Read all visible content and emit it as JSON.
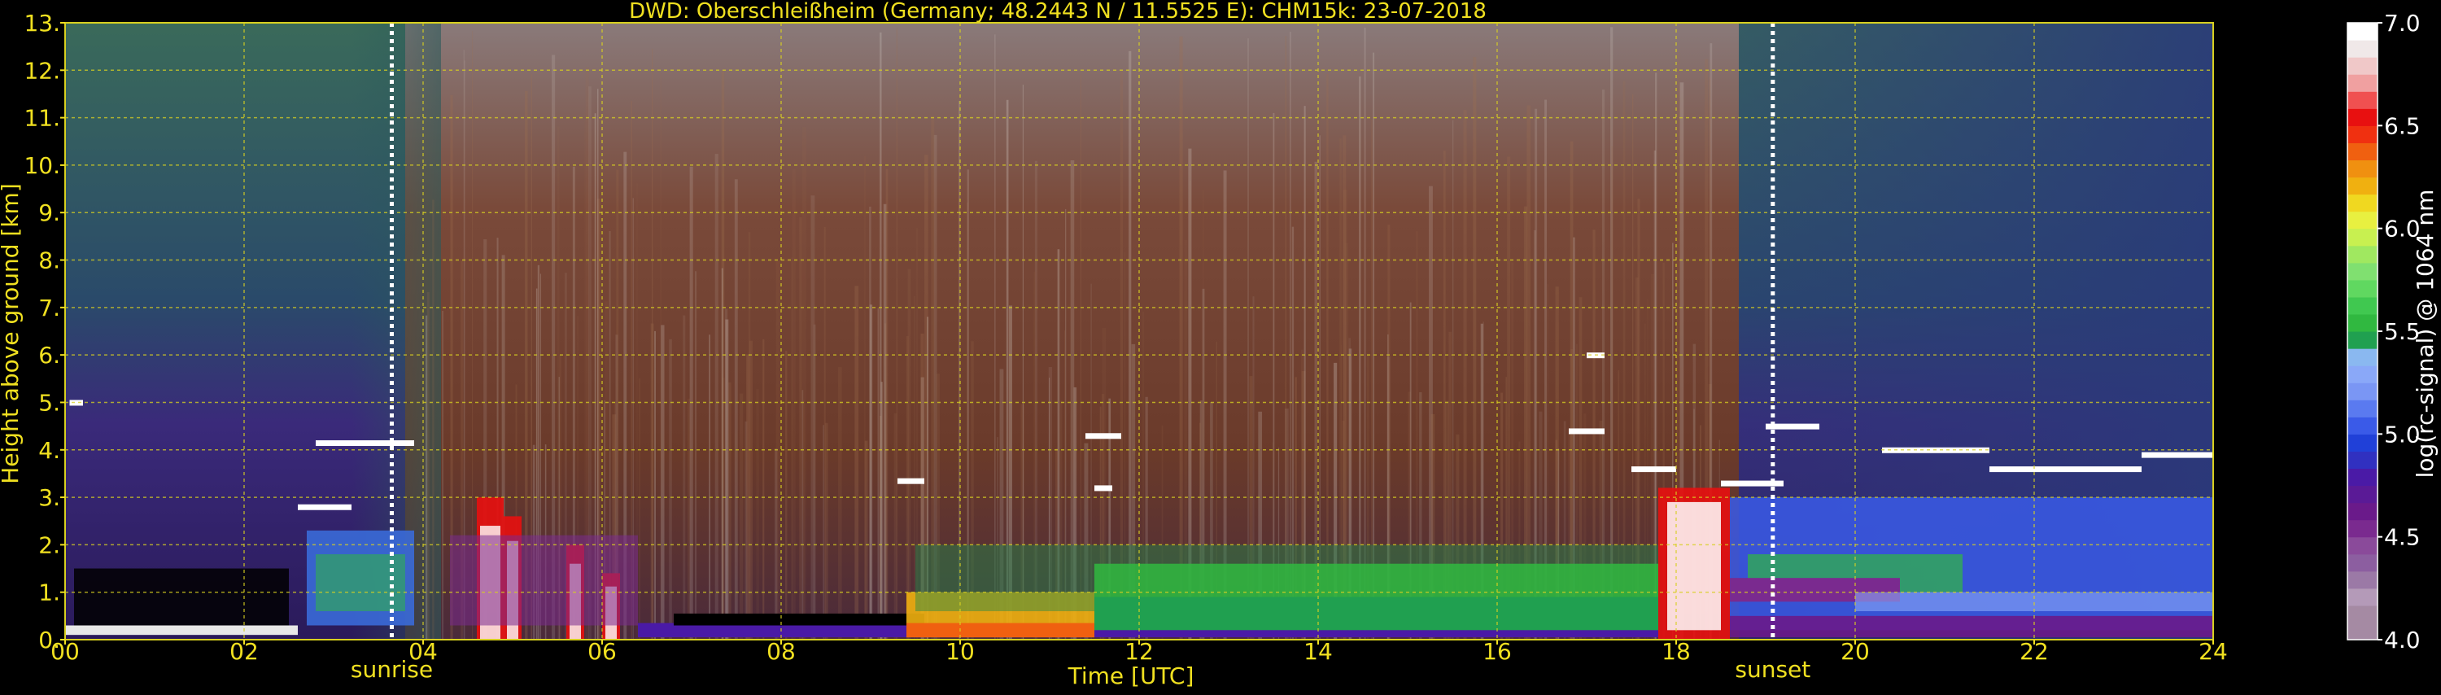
{
  "chart_data": {
    "type": "heatmap",
    "title": "DWD: Oberschleißheim (Germany; 48.2443 N / 11.5525 E):    CHM15k: 23-07-2018",
    "xlabel": "Time [UTC]",
    "ylabel": "Height above ground [km]",
    "xlim": [
      0,
      24
    ],
    "ylim": [
      0,
      13
    ],
    "x_ticks": [
      "00",
      "02",
      "04",
      "06",
      "08",
      "10",
      "12",
      "14",
      "16",
      "18",
      "20",
      "22",
      "24"
    ],
    "y_ticks": [
      "0.",
      "1.",
      "2.",
      "3.",
      "4.",
      "5.",
      "6.",
      "7.",
      "8.",
      "9.",
      "10.",
      "11.",
      "12.",
      "13."
    ],
    "grid": true,
    "colorbar": {
      "label": "log(rc-signal) @ 1064 nm",
      "range": [
        4.0,
        7.0
      ],
      "ticks": [
        "4.0",
        "4.5",
        "5.0",
        "5.5",
        "6.0",
        "6.5",
        "7.0"
      ],
      "colors": [
        "#a58aa3",
        "#a58aa3",
        "#b49ab8",
        "#9b79a6",
        "#8c5ea0",
        "#8a4a9a",
        "#7a2a8f",
        "#6a1a8a",
        "#5a1a96",
        "#4a1aa6",
        "#3030c0",
        "#2040d8",
        "#3a5ae8",
        "#5a7af0",
        "#7a96f4",
        "#8aa8f8",
        "#8ab8f0",
        "#20a050",
        "#30b840",
        "#40c850",
        "#60d860",
        "#80e070",
        "#a0e860",
        "#c8f050",
        "#e8f040",
        "#f0d820",
        "#f0b010",
        "#f09010",
        "#f06010",
        "#f03010",
        "#e81010",
        "#f05050",
        "#f0a0a0",
        "#f0c8c8",
        "#f0e8e8",
        "#ffffff"
      ]
    },
    "annotations": [
      {
        "label": "sunrise",
        "time": 3.65
      },
      {
        "label": "sunset",
        "time": 19.08
      }
    ],
    "cloud_base_segments": [
      {
        "t0": 0.05,
        "t1": 0.2,
        "h": 5.0
      },
      {
        "t0": 2.8,
        "t1": 3.9,
        "h": 4.15
      },
      {
        "t0": 2.6,
        "t1": 3.2,
        "h": 2.8
      },
      {
        "t0": 9.3,
        "t1": 9.6,
        "h": 3.35
      },
      {
        "t0": 11.4,
        "t1": 11.8,
        "h": 4.3
      },
      {
        "t0": 11.5,
        "t1": 11.7,
        "h": 3.2
      },
      {
        "t0": 17.0,
        "t1": 17.2,
        "h": 6.0
      },
      {
        "t0": 16.8,
        "t1": 17.2,
        "h": 4.4
      },
      {
        "t0": 17.5,
        "t1": 18.0,
        "h": 3.6
      },
      {
        "t0": 18.5,
        "t1": 19.2,
        "h": 3.3
      },
      {
        "t0": 19.0,
        "t1": 19.6,
        "h": 4.5
      },
      {
        "t0": 20.3,
        "t1": 21.5,
        "h": 4.0
      },
      {
        "t0": 21.5,
        "t1": 23.2,
        "h": 3.6
      },
      {
        "t0": 23.2,
        "t1": 24.0,
        "h": 3.9
      }
    ]
  }
}
